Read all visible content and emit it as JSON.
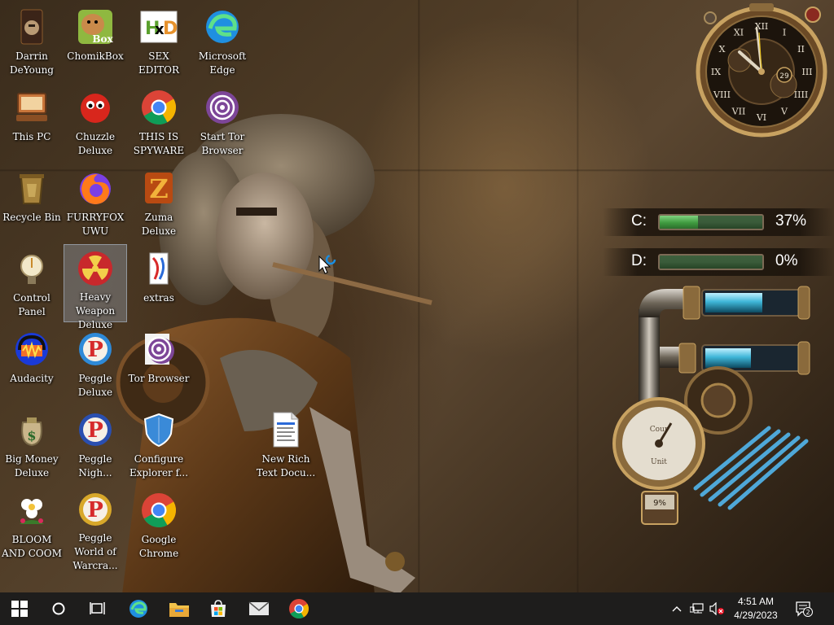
{
  "desktop": {
    "icons": [
      {
        "label": "Darrin DeYoung",
        "icon": "darrin-icon"
      },
      {
        "label": "ChomikBox",
        "icon": "chomikbox-icon"
      },
      {
        "label": "SEX EDITOR",
        "icon": "hxd-editor-icon"
      },
      {
        "label": "Microsoft Edge",
        "icon": "edge-icon"
      },
      {
        "label": "This PC",
        "icon": "this-pc-icon"
      },
      {
        "label": "Chuzzle Deluxe",
        "icon": "chuzzle-icon"
      },
      {
        "label": "THIS IS SPYWARE",
        "icon": "chrome-icon"
      },
      {
        "label": "Start Tor Browser",
        "icon": "tor-icon"
      },
      {
        "label": "Recycle Bin",
        "icon": "recycle-bin-icon"
      },
      {
        "label": "FURRYFOX UWU",
        "icon": "firefox-icon"
      },
      {
        "label": "Zuma Deluxe",
        "icon": "zuma-icon"
      },
      {
        "label": "Control Panel",
        "icon": "control-panel-icon"
      },
      {
        "label": "Heavy Weapon Deluxe",
        "icon": "heavy-weapon-icon"
      },
      {
        "label": "extras",
        "icon": "extras-icon"
      },
      {
        "label": "Audacity",
        "icon": "audacity-icon"
      },
      {
        "label": "Peggle Deluxe",
        "icon": "peggle-icon"
      },
      {
        "label": "Tor Browser",
        "icon": "tor-browser-icon"
      },
      {
        "label": "Big Money Deluxe",
        "icon": "big-money-icon"
      },
      {
        "label": "Peggle Nigh...",
        "icon": "peggle-nights-icon"
      },
      {
        "label": "Configure Explorer f...",
        "icon": "shield-icon"
      },
      {
        "label": "New Rich Text Docu...",
        "icon": "rtf-document-icon"
      },
      {
        "label": "BLOOM AND COOM",
        "icon": "bloom-icon"
      },
      {
        "label": "Peggle World of Warcra...",
        "icon": "peggle-wow-icon"
      },
      {
        "label": "Google Chrome",
        "icon": "chrome-icon"
      }
    ]
  },
  "widgets": {
    "clock": {
      "numerals": [
        "XII",
        "I",
        "II",
        "III",
        "IIII",
        "V",
        "VI",
        "VII",
        "VIII",
        "IX",
        "X",
        "XI"
      ],
      "date": "29"
    },
    "drives": [
      {
        "letter": "C:",
        "percent": "37%",
        "used_fraction": 0.37
      },
      {
        "letter": "D:",
        "percent": "0%",
        "used_fraction": 0.0
      }
    ],
    "gauge": {
      "top_text": "Cour",
      "bottom_text": "Unit",
      "readout": "9%"
    }
  },
  "taskbar": {
    "pinned": [
      {
        "name": "start-button",
        "icon": "windows-logo-icon"
      },
      {
        "name": "search-button",
        "icon": "cortana-circle-icon"
      },
      {
        "name": "task-view-button",
        "icon": "task-view-icon"
      },
      {
        "name": "edge-taskbar",
        "icon": "edge-icon"
      },
      {
        "name": "file-explorer-taskbar",
        "icon": "folder-icon"
      },
      {
        "name": "store-taskbar",
        "icon": "store-icon"
      },
      {
        "name": "mail-taskbar",
        "icon": "mail-icon"
      },
      {
        "name": "chrome-taskbar",
        "icon": "chrome-icon"
      }
    ],
    "time": "4:51 AM",
    "date": "4/29/2023",
    "notification_count": "2"
  },
  "colors": {
    "taskbar": "#1e1d1c",
    "wallpaper_base": "#4f3c26",
    "drive_fill": "#4caf50",
    "pipe_blue": "#3fb6d8"
  }
}
